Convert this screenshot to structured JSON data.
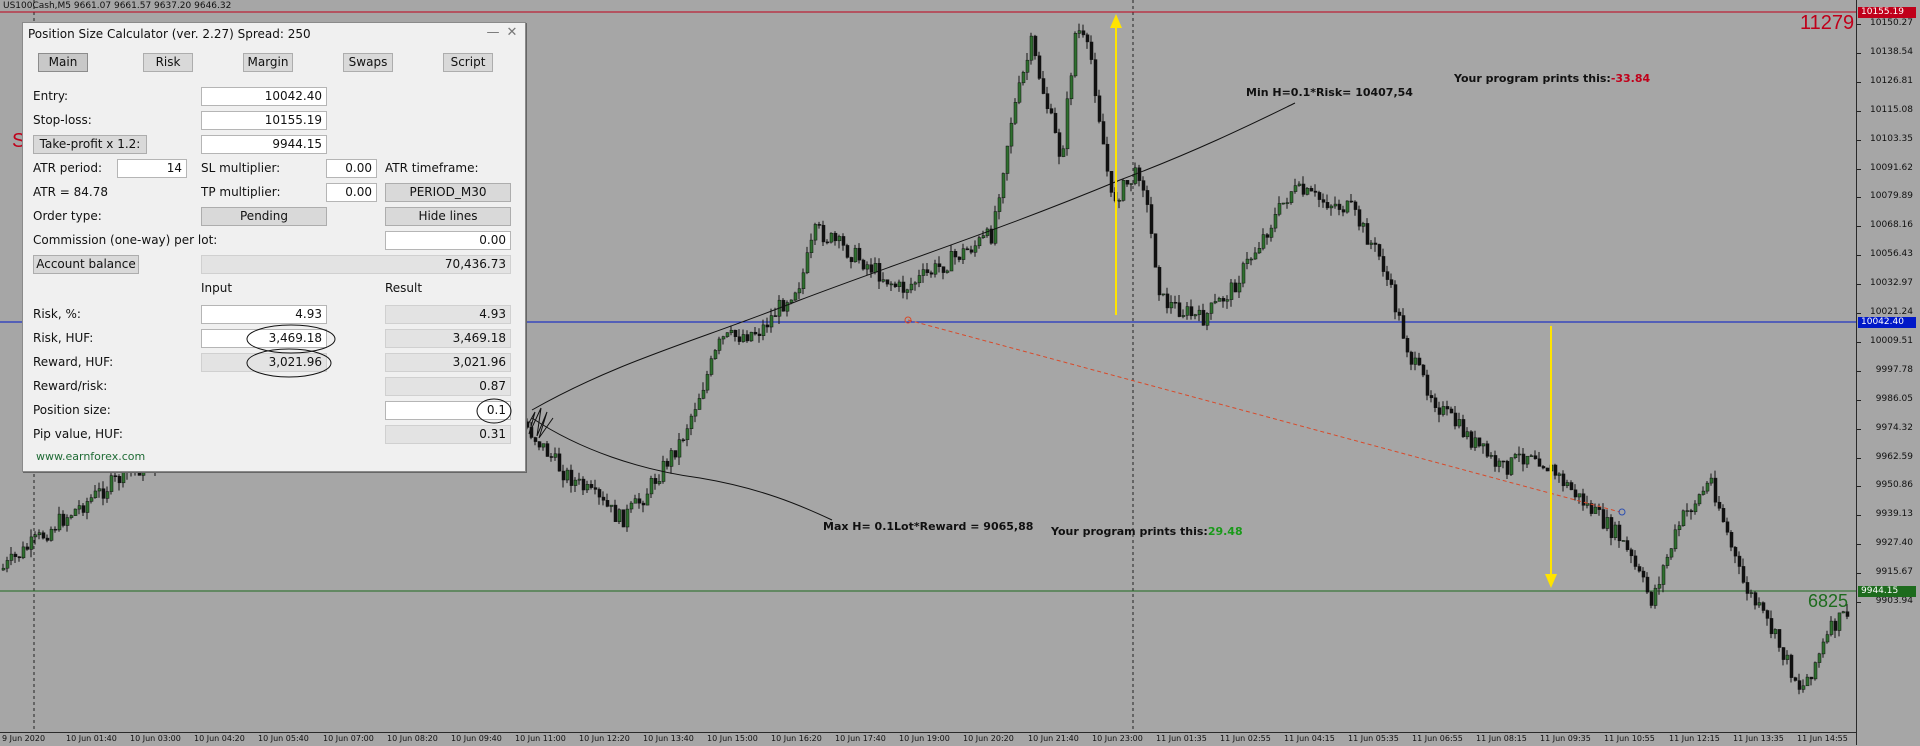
{
  "chart": {
    "symbol_info": "US100Cash,M5  9661.07 9661.57 9637.20 9646.32",
    "price_labels": [
      "10150.27",
      "10138.54",
      "10126.81",
      "10115.08",
      "10103.35",
      "10091.62",
      "10079.89",
      "10068.16",
      "10056.43",
      "10032.97",
      "10021.24",
      "10009.51",
      "9997.78",
      "9986.05",
      "9974.32",
      "9962.59",
      "9950.86",
      "9939.13",
      "9927.40",
      "9915.67",
      "9903.94"
    ],
    "time_labels": [
      "9 Jun 2020",
      "10 Jun 01:40",
      "10 Jun 03:00",
      "10 Jun 04:20",
      "10 Jun 05:40",
      "10 Jun 07:00",
      "10 Jun 08:20",
      "10 Jun 09:40",
      "10 Jun 11:00",
      "10 Jun 12:20",
      "10 Jun 13:40",
      "10 Jun 15:00",
      "10 Jun 16:20",
      "10 Jun 17:40",
      "10 Jun 19:00",
      "10 Jun 20:20",
      "10 Jun 21:40",
      "10 Jun 23:00",
      "11 Jun 01:35",
      "11 Jun 02:55",
      "11 Jun 04:15",
      "11 Jun 05:35",
      "11 Jun 06:55",
      "11 Jun 08:15",
      "11 Jun 09:35",
      "11 Jun 10:55",
      "11 Jun 12:15",
      "11 Jun 13:35",
      "11 Jun 14:55"
    ],
    "stop_loss_marker": "10155.19",
    "entry_marker": "10042.40",
    "take_profit_marker": "9944.15",
    "sl_level_text": "11279",
    "tp_level_text": "6825",
    "left_edge_text": "S",
    "colors": {
      "stop_loss": "#c0001a",
      "entry": "#0018c8",
      "take_profit": "#1d6b1d",
      "arrow": "#ffe400",
      "bull": "#2f6f2f",
      "bear": "#111111"
    }
  },
  "annotations": {
    "min_h": "Min H=0.1*Risk= 10407,54",
    "max_h": "Max H= 0.1Lot*Reward = 9065,88",
    "prints_top_label": "Your program prints this:",
    "prints_top_value": "-33.84",
    "prints_bottom_label": "Your program prints this:",
    "prints_bottom_value": "29.48"
  },
  "panel": {
    "title": "Position Size Calculator (ver. 2.27) Spread: 250",
    "minimize": "—",
    "close": "✕",
    "tabs": [
      "Main",
      "Risk",
      "Margin",
      "Swaps",
      "Script"
    ],
    "entry_label": "Entry:",
    "entry_value": "10042.40",
    "stoploss_label": "Stop-loss:",
    "stoploss_value": "10155.19",
    "takeprofit_button": "Take-profit x 1.2:",
    "takeprofit_value": "9944.15",
    "atr_period_label": "ATR period:",
    "atr_period_value": "14",
    "sl_multiplier_label": "SL multiplier:",
    "sl_multiplier_value": "0.00",
    "atr_timeframe_label": "ATR timeframe:",
    "atr_value_label": "ATR = 84.78",
    "tp_multiplier_label": "TP multiplier:",
    "tp_multiplier_value": "0.00",
    "atr_timeframe_button": "PERIOD_M30",
    "order_type_label": "Order type:",
    "order_type_button": "Pending",
    "hide_lines_button": "Hide lines",
    "commission_label": "Commission (one-way) per lot:",
    "commission_value": "0.00",
    "account_balance_button": "Account balance",
    "account_balance_value": "70,436.73",
    "input_header": "Input",
    "result_header": "Result",
    "risk_pct_label": "Risk, %:",
    "risk_pct_input": "4.93",
    "risk_pct_result": "4.93",
    "risk_huf_label": "Risk, HUF:",
    "risk_huf_input": "3,469.18",
    "risk_huf_result": "3,469.18",
    "reward_huf_label": "Reward, HUF:",
    "reward_huf_input": "3,021.96",
    "reward_huf_result": "3,021.96",
    "reward_risk_label": "Reward/risk:",
    "reward_risk_result": "0.87",
    "position_size_label": "Position size:",
    "position_size_result": "0.1",
    "pip_value_label": "Pip value, HUF:",
    "pip_value_result": "0.31",
    "website": "www.earnforex.com"
  }
}
